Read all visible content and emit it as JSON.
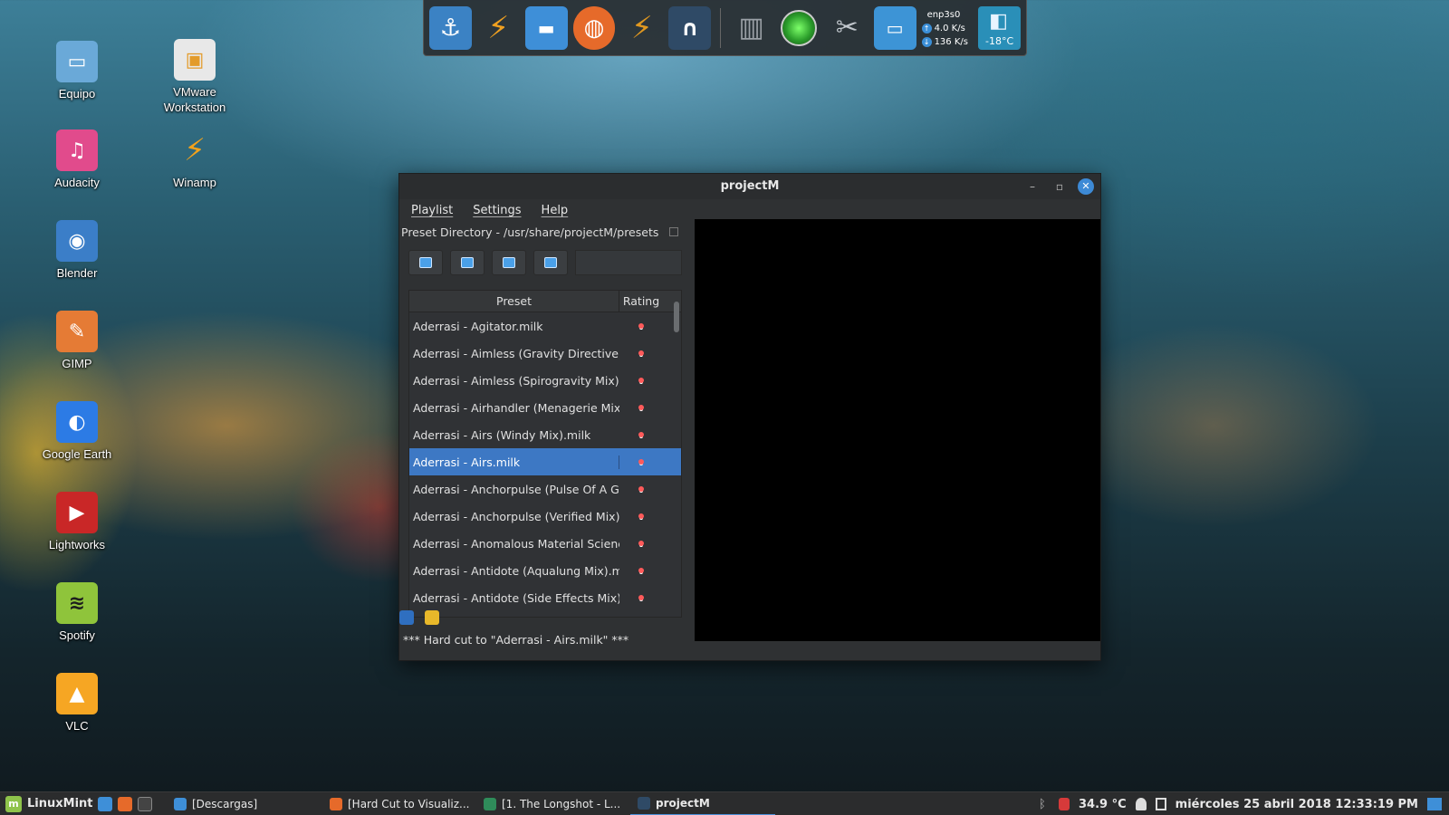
{
  "desktop": {
    "icons": [
      {
        "label": "Equipo",
        "icon": "computer-icon",
        "color": "#6aa9d8"
      },
      {
        "label": "VMware Workstation",
        "icon": "vmware-icon",
        "color": "#e8e8e8"
      },
      {
        "label": "Audacity",
        "icon": "audacity-icon",
        "color": "#e14b8c"
      },
      {
        "label": "Winamp",
        "icon": "winamp-icon",
        "color": "#f3a21b"
      },
      {
        "label": "Blender",
        "icon": "blender-icon",
        "color": "#3b7ec8"
      },
      {
        "label": "GIMP",
        "icon": "gimp-icon",
        "color": "#e57b35"
      },
      {
        "label": "Google Earth",
        "icon": "google-earth-icon",
        "color": "#2c7be5"
      },
      {
        "label": "Lightworks",
        "icon": "lightworks-icon",
        "color": "#c92727"
      },
      {
        "label": "Spotify",
        "icon": "spotify-icon",
        "color": "#8fc43b"
      },
      {
        "label": "VLC",
        "icon": "vlc-icon",
        "color": "#f6a623"
      }
    ]
  },
  "dock": {
    "items": [
      {
        "icon": "anchor-icon",
        "color": "#3b82c4"
      },
      {
        "icon": "winamp-icon",
        "color": "#f0a020"
      },
      {
        "icon": "folder-icon",
        "color": "#3e8fd8"
      },
      {
        "icon": "firefox-icon",
        "color": "#e66a2a"
      },
      {
        "icon": "winamp-icon",
        "color": "#e09820"
      },
      {
        "icon": "headphones-icon",
        "color": "#2f4a66"
      }
    ],
    "items2": [
      {
        "icon": "trash-icon",
        "color": "#8a8f95"
      },
      {
        "icon": "green-circle-icon",
        "color": "#3fbf3f"
      },
      {
        "icon": "scissors-icon",
        "color": "#a7adb3"
      },
      {
        "icon": "window-icon",
        "color": "#3d94d6"
      }
    ],
    "network": {
      "iface": "enp3s0",
      "up": "4.0 K/s",
      "down": "136 K/s"
    },
    "weather": {
      "temp": "-18°C"
    }
  },
  "window": {
    "title": "projectM",
    "menu": [
      "Playlist",
      "Settings",
      "Help"
    ],
    "preset_directory": "Preset Directory - /usr/share/projectM/presets",
    "toolbar_buttons": [
      "add-preset-icon",
      "edit-icon",
      "save-icon",
      "list-icon"
    ],
    "table": {
      "headers": {
        "preset": "Preset",
        "rating": "Rating"
      },
      "rows": [
        "Aderrasi - Agitator.milk",
        "Aderrasi - Aimless (Gravity Directive Mi...",
        "Aderrasi - Aimless (Spirogravity Mix).m...",
        "Aderrasi - Airhandler (Menagerie Mix)....",
        "Aderrasi - Airs (Windy Mix).milk",
        "Aderrasi - Airs.milk",
        "Aderrasi - Anchorpulse (Pulse Of A Gha...",
        "Aderrasi - Anchorpulse (Verified Mix)....",
        "Aderrasi - Anomalous Material Science...",
        "Aderrasi - Antidote (Aqualung Mix).milk",
        "Aderrasi - Antidote (Side Effects Mix).m..."
      ],
      "selected_index": 5
    },
    "status": "*** Hard cut to \"Aderrasi - Airs.milk\" ***"
  },
  "taskbar": {
    "menu_label": "LinuxMint",
    "tasks": [
      {
        "label": "[Descargas]",
        "color": "#3e8fd8"
      },
      {
        "label": "[Hard Cut to Visualiz...",
        "color": "#e66a2a"
      },
      {
        "label": "[1. The Longshot - L...",
        "color": "#2f8c5a"
      },
      {
        "label": "projectM",
        "color": "#2f4a66",
        "active": true
      }
    ],
    "tray": {
      "temperature": "34.9 °C",
      "datetime": "miércoles 25 abril 2018 12:33:19 PM"
    }
  }
}
